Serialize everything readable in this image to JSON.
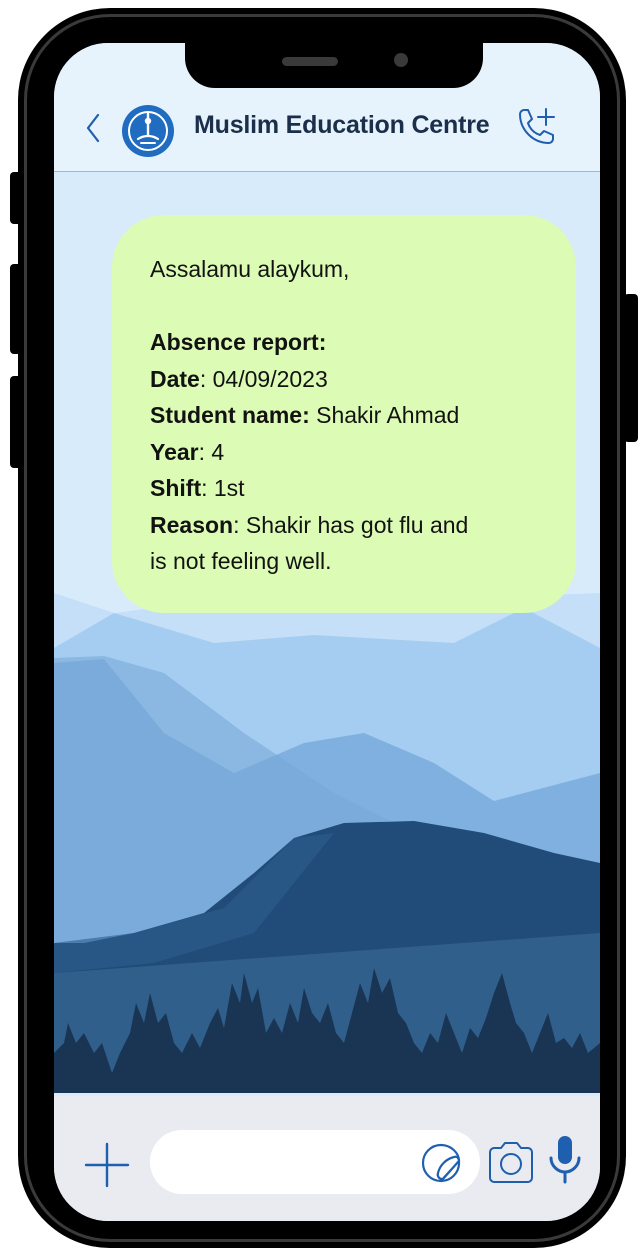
{
  "header": {
    "contact_name": "Muslim Education Centre",
    "avatar_color": "#1f6cc0"
  },
  "message": {
    "greeting": "Assalamu alaykum,",
    "report_title": "Absence report:",
    "date_label": "Date",
    "date_value": ": 04/09/2023",
    "student_label": "Student name:",
    "student_value": " Shakir Ahmad",
    "year_label": "Year",
    "year_value": ": 4",
    "shift_label": "Shift",
    "shift_value": ": 1st",
    "reason_label": "Reason",
    "reason_value_line1": ": Shakir has got flu and",
    "reason_value_line2": "is not feeling well.",
    "bubble_color": "#dcfbb4"
  },
  "composer": {
    "input_value": "",
    "accent_color": "#1f5fb0"
  },
  "icons": {
    "back": "chevron-left-icon",
    "call": "add-call-icon",
    "plus": "plus-icon",
    "sticker": "sticker-icon",
    "camera": "camera-icon",
    "mic": "microphone-icon"
  }
}
